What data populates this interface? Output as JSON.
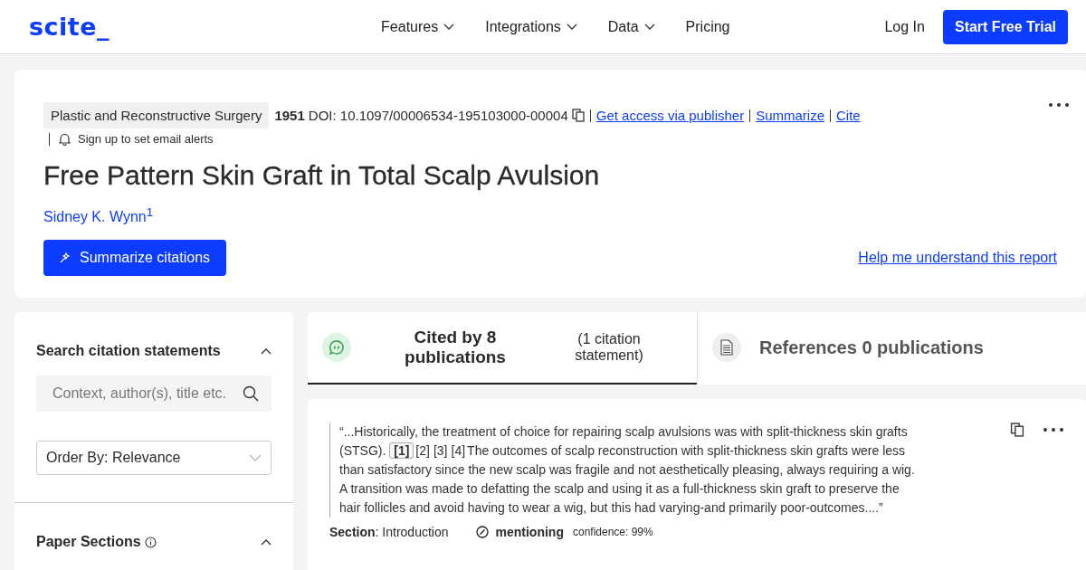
{
  "header": {
    "logo": "scite_",
    "nav": [
      {
        "label": "Features",
        "has_menu": true
      },
      {
        "label": "Integrations",
        "has_menu": true
      },
      {
        "label": "Data",
        "has_menu": true
      },
      {
        "label": "Pricing",
        "has_menu": false
      }
    ],
    "login": "Log In",
    "cta": "Start Free Trial"
  },
  "paper": {
    "journal": "Plastic and Reconstructive Surgery",
    "year": "1951",
    "doi": "DOI: 10.1097/00006534-195103000-00004",
    "links": [
      "Get access via publisher",
      "Summarize",
      "Cite"
    ],
    "alerts": "Sign up to set email alerts",
    "title": "Free Pattern Skin Graft in Total Scalp Avulsion",
    "author": "Sidney K. Wynn$^{1}$",
    "summarize_button": "Summarize citations",
    "help_link": "Help me understand this report"
  },
  "sidebar": {
    "search_title": "Search citation statements",
    "search": {
      "placeholder": "Context, author(s), title etc."
    },
    "order_by": "Order By: Relevance",
    "sections_title": "Paper Sections"
  },
  "tabs": [
    {
      "kind": "cited",
      "title": "Cited by 8 publications",
      "note": "(1 citation statement)",
      "selected": true
    },
    {
      "kind": "references",
      "title": "References 0 publications",
      "selected": false
    }
  ],
  "citation": {
    "before": "“...Historically, the treatment of choice for repairing scalp avulsions was with split-thickness skin grafts (STSG).",
    "refs": [
      {
        "label": "[1]",
        "selected": true
      },
      {
        "label": "[2]",
        "selected": false
      },
      {
        "label": "[3]",
        "selected": false
      },
      {
        "label": "[4]",
        "selected": false
      }
    ],
    "after": "The outcomes of scalp reconstruction with split-thickness skin grafts were less than satisfactory since the new scalp was fragile and not aesthetically pleasing, always requiring a wig. A transition was made to defatting the scalp and using it as a full-thickness skin graft to preserve the hair follicles and avoid having to wear a wig, but this had varying-and primarily poor-outcomes....”",
    "section": "**Section**: Introduction",
    "type": "mentioning",
    "confidence": "confidence: 99%"
  }
}
